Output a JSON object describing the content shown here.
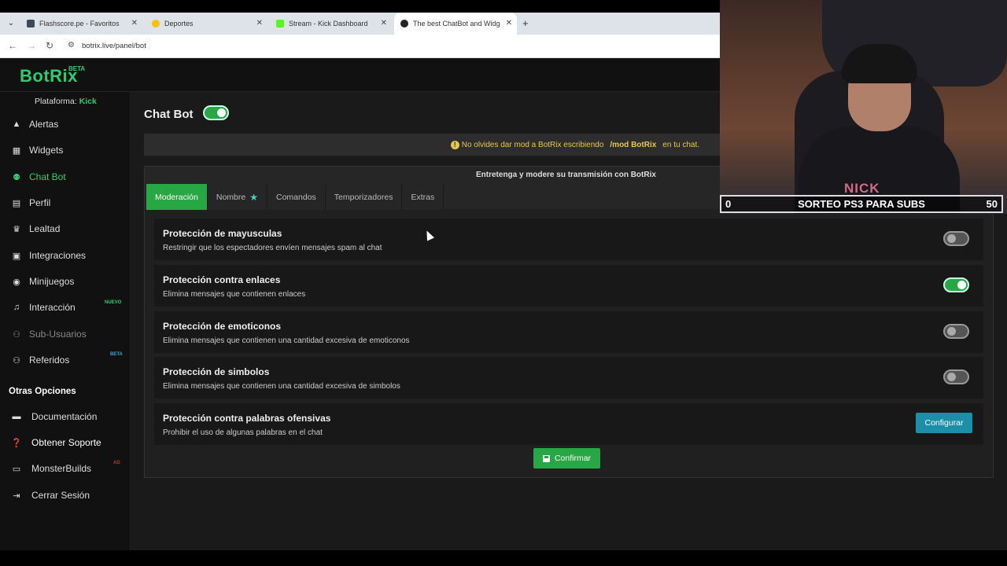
{
  "browser": {
    "tabs": [
      {
        "title": "Flashscore.pe - Favoritos",
        "favicon_color": "#3a4a5a"
      },
      {
        "title": "Deportes",
        "favicon_color": "#f4c20d"
      },
      {
        "title": "Stream - Kick Dashboard",
        "favicon_color": "#53fc18"
      },
      {
        "title": "The best ChatBot and Widgets",
        "favicon_color": "#222222"
      }
    ],
    "url": "botrix.live/panel/bot"
  },
  "app": {
    "logo": "BotRix",
    "logo_badge": "BETA",
    "platform_label": "Plataforma:",
    "platform_value": "Kick",
    "sidebar": [
      {
        "label": "Alertas",
        "icon": "warning-icon"
      },
      {
        "label": "Widgets",
        "icon": "grid-icon"
      },
      {
        "label": "Chat Bot",
        "icon": "robot-icon"
      },
      {
        "label": "Perfil",
        "icon": "id-card-icon"
      },
      {
        "label": "Lealtad",
        "icon": "trophy-icon"
      },
      {
        "label": "Integraciones",
        "icon": "plug-icon"
      },
      {
        "label": "Minijuegos",
        "icon": "gamepad-icon"
      },
      {
        "label": "Interacción",
        "icon": "music-icon",
        "badge": "NUEVO"
      },
      {
        "label": "Sub-Usuarios",
        "icon": "users-icon"
      },
      {
        "label": "Referidos",
        "icon": "user-group-icon",
        "badge": "BETA"
      }
    ],
    "other_title": "Otras Opciones",
    "other": [
      {
        "label": "Documentación",
        "icon": "book-icon"
      },
      {
        "label": "Obtener Soporte",
        "icon": "question-icon"
      },
      {
        "label": "MonsterBuilds",
        "icon": "laptop-icon",
        "badge": "AD"
      },
      {
        "label": "Cerrar Sesión",
        "icon": "logout-icon"
      }
    ]
  },
  "main": {
    "title": "Chat Bot",
    "bot_enabled": true,
    "alert_prefix": "No olvides dar mod a BotRix escribiendo",
    "alert_command": "/mod BotRix",
    "alert_suffix": "en tu chat.",
    "panel_subtitle": "Entretenga y modere su transmisión con BotRix",
    "tabs": [
      "Moderación",
      "Nombre",
      "Comandos",
      "Temporizadores",
      "Extras"
    ],
    "rows": [
      {
        "title": "Protección de mayusculas",
        "desc": "Restringir que los espectadores envíen mensajes spam al chat",
        "enabled": false
      },
      {
        "title": "Protección contra enlaces",
        "desc": "Elimina mensajes que contienen enlaces",
        "enabled": true
      },
      {
        "title": "Protección de emoticonos",
        "desc": "Elimina mensajes que contienen una cantidad excesiva de emoticonos",
        "enabled": false
      },
      {
        "title": "Protección de simbolos",
        "desc": "Elimina mensajes que contienen una cantidad excesiva de simbolos",
        "enabled": false
      },
      {
        "title": "Protección contra palabras ofensivas",
        "desc": "Prohibir el uso de algunas palabras en el chat"
      }
    ],
    "configure_label": "Configurar",
    "confirm_label": "Confirmar"
  },
  "overlay": {
    "left": "0",
    "center": "SORTEO PS3 PARA SUBS",
    "right": "50",
    "shirt_text": "NICK"
  }
}
